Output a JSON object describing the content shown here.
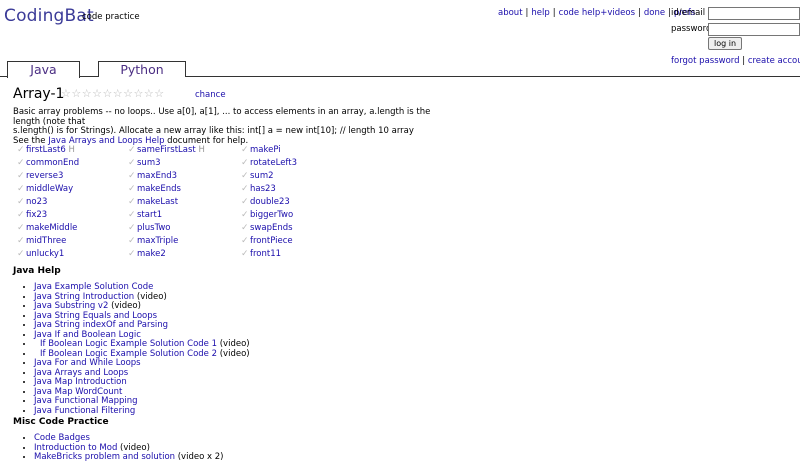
{
  "header": {
    "logo": "CodingBat",
    "tagline": "code practice",
    "nav": [
      "about",
      "help",
      "code help+videos",
      "done",
      "prefs"
    ]
  },
  "login": {
    "id_label": "id/email",
    "password_label": "password",
    "button": "log in",
    "forgot": "forgot password",
    "create": "create account"
  },
  "tabs": [
    "Java",
    "Python"
  ],
  "page": {
    "title": "Array-1",
    "chance": "chance",
    "desc1": "Basic array problems -- no loops.. Use a[0], a[1], ... to access elements in an array, a.length is the length (note that",
    "desc2": "s.length() is for Strings). Allocate a new array like this: int[] a = new int[10]; // length 10 array",
    "see_prefix": "See the ",
    "see_link": "Java Arrays and Loops Help",
    "see_suffix": " document for help."
  },
  "problems": {
    "col1": [
      "firstLast6",
      "commonEnd",
      "reverse3",
      "middleWay",
      "no23",
      "fix23",
      "makeMiddle",
      "midThree",
      "unlucky1"
    ],
    "col2": [
      "sameFirstLast",
      "sum3",
      "maxEnd3",
      "makeEnds",
      "makeLast",
      "start1",
      "plusTwo",
      "maxTriple",
      "make2"
    ],
    "col3": [
      "makePi",
      "rotateLeft3",
      "sum2",
      "has23",
      "double23",
      "biggerTwo",
      "swapEnds",
      "frontPiece",
      "front11"
    ],
    "hint_mark": "H"
  },
  "java_help": {
    "heading": "Java Help",
    "items": [
      {
        "link": "Java Example Solution Code",
        "suffix": ""
      },
      {
        "link": "Java String Introduction",
        "suffix": " (video)"
      },
      {
        "link": "Java Substring v2",
        "suffix": " (video)"
      },
      {
        "link": "Java String Equals and Loops",
        "suffix": ""
      },
      {
        "link": "Java String indexOf and Parsing",
        "suffix": ""
      },
      {
        "link": "Java If and Boolean Logic",
        "suffix": ""
      },
      {
        "link": "If Boolean Logic Example Solution Code 1",
        "suffix": " (video)"
      },
      {
        "link": "If Boolean Logic Example Solution Code 2",
        "suffix": " (video)"
      },
      {
        "link": "Java For and While Loops",
        "suffix": ""
      },
      {
        "link": "Java Arrays and Loops",
        "suffix": ""
      },
      {
        "link": "Java Map Introduction",
        "suffix": ""
      },
      {
        "link": "Java Map WordCount",
        "suffix": ""
      },
      {
        "link": "Java Functional Mapping",
        "suffix": ""
      },
      {
        "link": "Java Functional Filtering",
        "suffix": ""
      }
    ]
  },
  "misc": {
    "heading": "Misc Code Practice",
    "items": [
      {
        "link": "Code Badges",
        "suffix": ""
      },
      {
        "link": "Introduction to Mod",
        "suffix": " (video)"
      },
      {
        "link": "MakeBricks problem and solution",
        "suffix": " (video x 2)"
      }
    ]
  }
}
